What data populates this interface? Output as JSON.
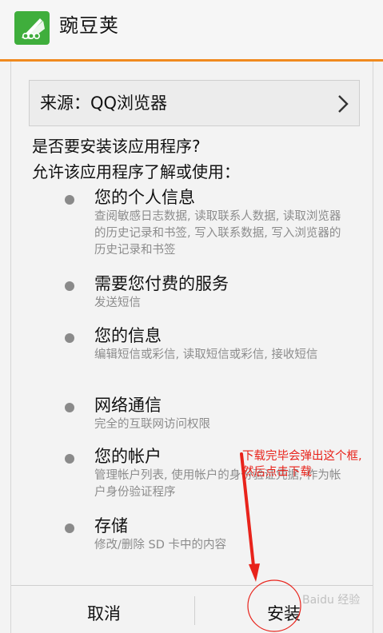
{
  "header": {
    "app_name": "豌豆荚",
    "app_icon": "wandoujia-pea-pod-icon",
    "accent_color": "#f08a1f",
    "icon_color": "#3fae3c"
  },
  "source": {
    "label": "来源：QQ浏览器",
    "chevron_icon": "chevron-right-icon"
  },
  "prompt": {
    "question": "是否要安装该应用程序?",
    "allow_text": "允许该应用程序了解或使用："
  },
  "permissions": [
    {
      "title": "您的个人信息",
      "description": "查阅敏感日志数据, 读取联系人数据, 读取浏览器的历史记录和书签, 写入联系数据, 写入浏览器的历史记录和书签"
    },
    {
      "title": "需要您付费的服务",
      "description": "发送短信"
    },
    {
      "title": "您的信息",
      "description": "编辑短信或彩信, 读取短信或彩信, 接收短信"
    },
    {
      "title": "网络通信",
      "description": "完全的互联网访问权限"
    },
    {
      "title": "您的帐户",
      "description": "管理帐户列表, 使用帐户的身份验证凭据, 作为帐户身份验证程序"
    },
    {
      "title": "存储",
      "description": "修改/删除 SD 卡中的内容"
    }
  ],
  "buttons": {
    "cancel": "取消",
    "install": "安装"
  },
  "annotation": {
    "text": "下载完毕会弹出这个框, 然后点击下载",
    "color": "#e8231b"
  },
  "watermark": {
    "text": "Baidu 经验"
  }
}
